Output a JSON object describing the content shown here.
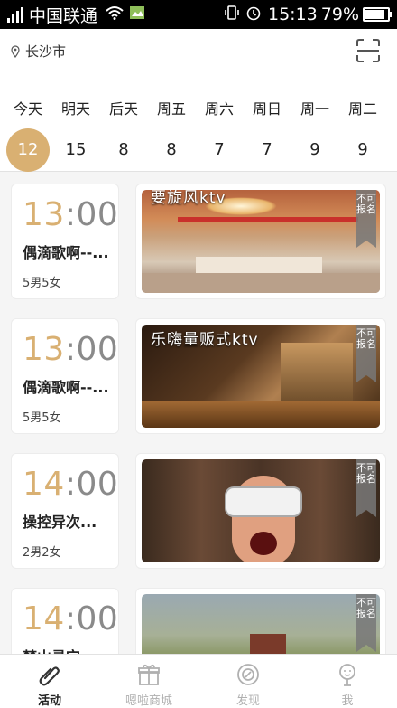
{
  "status_bar": {
    "carrier": "中国联通",
    "time": "15:13",
    "battery": "79%"
  },
  "header": {
    "city": "长沙市"
  },
  "days": [
    {
      "weekday": "今天",
      "count": "12",
      "selected": true
    },
    {
      "weekday": "明天",
      "count": "15"
    },
    {
      "weekday": "后天",
      "count": "8"
    },
    {
      "weekday": "周五",
      "count": "8"
    },
    {
      "weekday": "周六",
      "count": "7"
    },
    {
      "weekday": "周日",
      "count": "7"
    },
    {
      "weekday": "周一",
      "count": "9"
    },
    {
      "weekday": "周二",
      "count": "9"
    }
  ],
  "events": [
    {
      "hour": "13",
      "minute": ":00",
      "title": "偶滴歌啊--...",
      "people": "5男5女",
      "caption": "要旋风ktv",
      "badge": "不可报名"
    },
    {
      "hour": "13",
      "minute": ":00",
      "title": "偶滴歌啊--...",
      "people": "5男5女",
      "caption": "乐嗨量贩式ktv",
      "badge": "不可报名"
    },
    {
      "hour": "14",
      "minute": ":00",
      "title": "操控异次...",
      "people": "2男2女",
      "caption": "",
      "badge": "不可报名"
    },
    {
      "hour": "14",
      "minute": ":00",
      "title": "梦山寻宝",
      "people": "",
      "caption": "",
      "badge": "不可报名"
    }
  ],
  "tabs": [
    {
      "label": "活动",
      "icon": "paperclip-icon",
      "active": true
    },
    {
      "label": "嗯啦商城",
      "icon": "gift-icon"
    },
    {
      "label": "发现",
      "icon": "compass-icon"
    },
    {
      "label": "我",
      "icon": "person-icon"
    }
  ],
  "colors": {
    "accent": "#d9b072",
    "inactive": "#b0b0b0"
  }
}
